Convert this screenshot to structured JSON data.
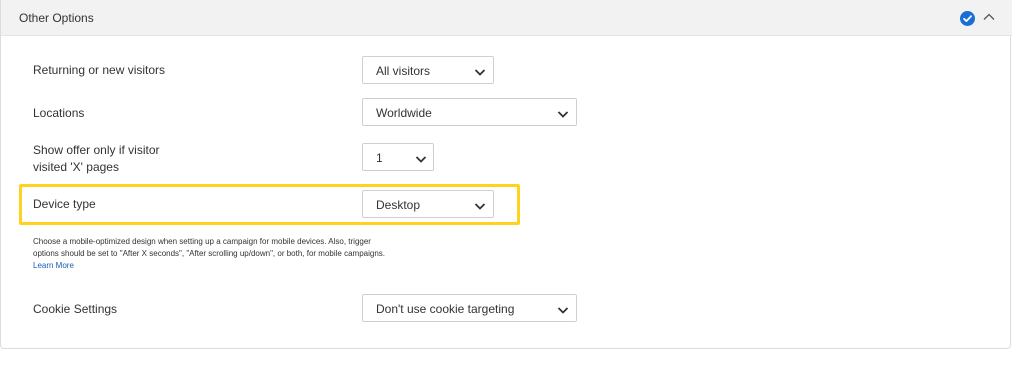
{
  "section": {
    "title": "Other Options"
  },
  "fields": {
    "returning": {
      "label": "Returning or new visitors",
      "value": "All visitors"
    },
    "locations": {
      "label": "Locations",
      "value": "Worldwide"
    },
    "pages": {
      "label_line1": "Show offer only if visitor",
      "label_line2": "visited 'X' pages",
      "value": "1"
    },
    "device": {
      "label": "Device type",
      "value": "Desktop"
    },
    "cookie": {
      "label": "Cookie Settings",
      "value": "Don't use cookie targeting"
    }
  },
  "device_help": {
    "line1": "Choose a mobile-optimized design when setting up a campaign for mobile devices. Also, trigger",
    "line2": "options should be set to \"After X seconds\", \"After scrolling up/down\", or both, for mobile campaigns.",
    "learn_more": "Learn More"
  },
  "colors": {
    "highlight": "#ffd21f",
    "accent": "#1a6fd6",
    "link": "#1a5fb4"
  },
  "icons": {
    "status": "check-circle-icon",
    "collapse": "chevron-up-icon",
    "dropdown": "chevron-down-icon"
  }
}
